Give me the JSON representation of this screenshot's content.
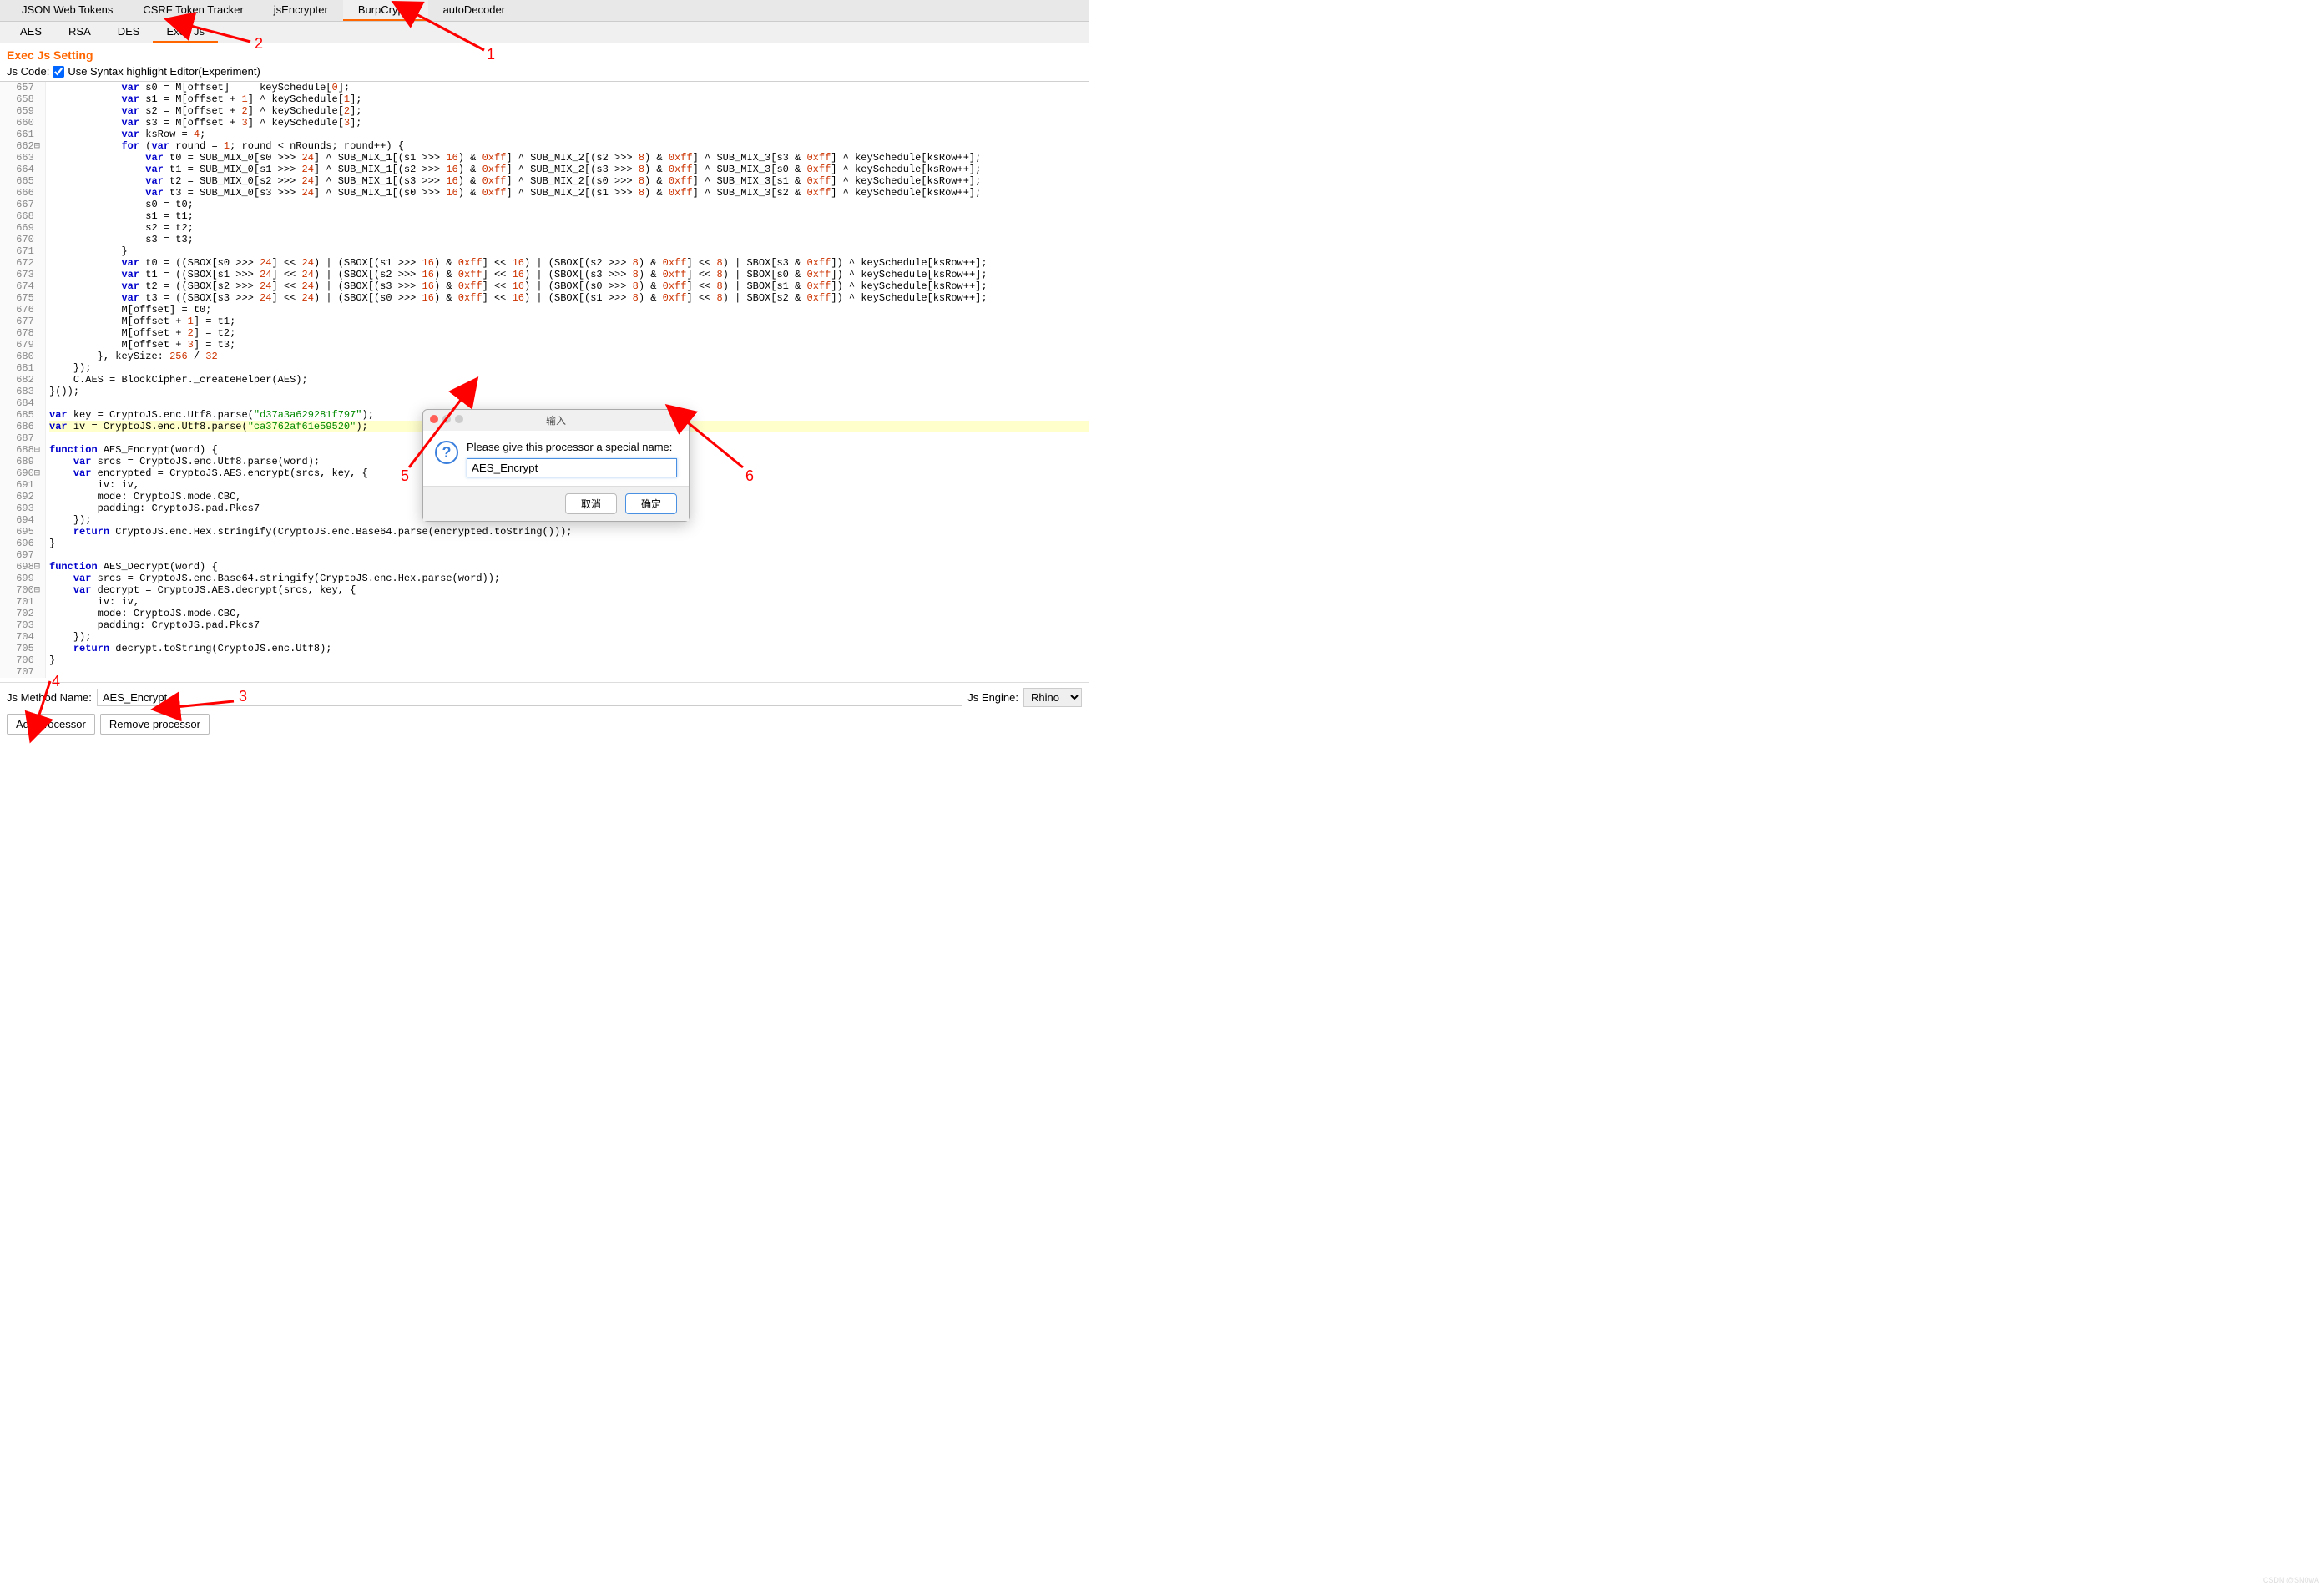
{
  "top_tabs": [
    "JSON Web Tokens",
    "CSRF Token Tracker",
    "jsEncrypter",
    "BurpCrypto",
    "autoDecoder"
  ],
  "top_active": "BurpCrypto",
  "sub_tabs": [
    "AES",
    "RSA",
    "DES",
    "Exec Js"
  ],
  "sub_active": "Exec Js",
  "section_title": "Exec Js Setting",
  "jscode_label": "Js Code:",
  "syntax_label": "Use Syntax highlight Editor(Experiment)",
  "syntax_checked": true,
  "method_label": "Js Method Name:",
  "method_value": "AES_Encrypt",
  "engine_label": "Js Engine:",
  "engine_value": "Rhino",
  "btn_add": "Add processor",
  "btn_remove": "Remove processor",
  "dialog": {
    "title": "输入",
    "prompt": "Please give this processor a special name:",
    "value": "AES_Encrypt",
    "cancel": "取消",
    "ok": "确定"
  },
  "annotations": [
    "1",
    "2",
    "3",
    "4",
    "5",
    "6"
  ],
  "gutter_start": 657,
  "gutter_end": 707,
  "code_lines": [
    {
      "n": 657,
      "html": "            <span class='kw'>var</span> s0 = M[offset]     keySchedule[<span class='num'>0</span>];"
    },
    {
      "n": 658,
      "html": "            <span class='kw'>var</span> s1 = M[offset + <span class='num'>1</span>] ^ keySchedule[<span class='num'>1</span>];"
    },
    {
      "n": 659,
      "html": "            <span class='kw'>var</span> s2 = M[offset + <span class='num'>2</span>] ^ keySchedule[<span class='num'>2</span>];"
    },
    {
      "n": 660,
      "html": "            <span class='kw'>var</span> s3 = M[offset + <span class='num'>3</span>] ^ keySchedule[<span class='num'>3</span>];"
    },
    {
      "n": 661,
      "html": "            <span class='kw'>var</span> ksRow = <span class='num'>4</span>;"
    },
    {
      "n": 662,
      "fold": "⊟",
      "html": "            <span class='kw'>for</span> (<span class='kw'>var</span> round = <span class='num'>1</span>; round &lt; nRounds; round++) {"
    },
    {
      "n": 663,
      "html": "                <span class='kw'>var</span> t0 = SUB_MIX_0[s0 &gt;&gt;&gt; <span class='num'>24</span>] ^ SUB_MIX_1[(s1 &gt;&gt;&gt; <span class='num'>16</span>) &amp; <span class='num'>0xff</span>] ^ SUB_MIX_2[(s2 &gt;&gt;&gt; <span class='num'>8</span>) &amp; <span class='num'>0xff</span>] ^ SUB_MIX_3[s3 &amp; <span class='num'>0xff</span>] ^ keySchedule[ksRow++];"
    },
    {
      "n": 664,
      "html": "                <span class='kw'>var</span> t1 = SUB_MIX_0[s1 &gt;&gt;&gt; <span class='num'>24</span>] ^ SUB_MIX_1[(s2 &gt;&gt;&gt; <span class='num'>16</span>) &amp; <span class='num'>0xff</span>] ^ SUB_MIX_2[(s3 &gt;&gt;&gt; <span class='num'>8</span>) &amp; <span class='num'>0xff</span>] ^ SUB_MIX_3[s0 &amp; <span class='num'>0xff</span>] ^ keySchedule[ksRow++];"
    },
    {
      "n": 665,
      "html": "                <span class='kw'>var</span> t2 = SUB_MIX_0[s2 &gt;&gt;&gt; <span class='num'>24</span>] ^ SUB_MIX_1[(s3 &gt;&gt;&gt; <span class='num'>16</span>) &amp; <span class='num'>0xff</span>] ^ SUB_MIX_2[(s0 &gt;&gt;&gt; <span class='num'>8</span>) &amp; <span class='num'>0xff</span>] ^ SUB_MIX_3[s1 &amp; <span class='num'>0xff</span>] ^ keySchedule[ksRow++];"
    },
    {
      "n": 666,
      "html": "                <span class='kw'>var</span> t3 = SUB_MIX_0[s3 &gt;&gt;&gt; <span class='num'>24</span>] ^ SUB_MIX_1[(s0 &gt;&gt;&gt; <span class='num'>16</span>) &amp; <span class='num'>0xff</span>] ^ SUB_MIX_2[(s1 &gt;&gt;&gt; <span class='num'>8</span>) &amp; <span class='num'>0xff</span>] ^ SUB_MIX_3[s2 &amp; <span class='num'>0xff</span>] ^ keySchedule[ksRow++];"
    },
    {
      "n": 667,
      "html": "                s0 = t0;"
    },
    {
      "n": 668,
      "html": "                s1 = t1;"
    },
    {
      "n": 669,
      "html": "                s2 = t2;"
    },
    {
      "n": 670,
      "html": "                s3 = t3;"
    },
    {
      "n": 671,
      "html": "            }"
    },
    {
      "n": 672,
      "html": "            <span class='kw'>var</span> t0 = ((SBOX[s0 &gt;&gt;&gt; <span class='num'>24</span>] &lt;&lt; <span class='num'>24</span>) | (SBOX[(s1 &gt;&gt;&gt; <span class='num'>16</span>) &amp; <span class='num'>0xff</span>] &lt;&lt; <span class='num'>16</span>) | (SBOX[(s2 &gt;&gt;&gt; <span class='num'>8</span>) &amp; <span class='num'>0xff</span>] &lt;&lt; <span class='num'>8</span>) | SBOX[s3 &amp; <span class='num'>0xff</span>]) ^ keySchedule[ksRow++];"
    },
    {
      "n": 673,
      "html": "            <span class='kw'>var</span> t1 = ((SBOX[s1 &gt;&gt;&gt; <span class='num'>24</span>] &lt;&lt; <span class='num'>24</span>) | (SBOX[(s2 &gt;&gt;&gt; <span class='num'>16</span>) &amp; <span class='num'>0xff</span>] &lt;&lt; <span class='num'>16</span>) | (SBOX[(s3 &gt;&gt;&gt; <span class='num'>8</span>) &amp; <span class='num'>0xff</span>] &lt;&lt; <span class='num'>8</span>) | SBOX[s0 &amp; <span class='num'>0xff</span>]) ^ keySchedule[ksRow++];"
    },
    {
      "n": 674,
      "html": "            <span class='kw'>var</span> t2 = ((SBOX[s2 &gt;&gt;&gt; <span class='num'>24</span>] &lt;&lt; <span class='num'>24</span>) | (SBOX[(s3 &gt;&gt;&gt; <span class='num'>16</span>) &amp; <span class='num'>0xff</span>] &lt;&lt; <span class='num'>16</span>) | (SBOX[(s0 &gt;&gt;&gt; <span class='num'>8</span>) &amp; <span class='num'>0xff</span>] &lt;&lt; <span class='num'>8</span>) | SBOX[s1 &amp; <span class='num'>0xff</span>]) ^ keySchedule[ksRow++];"
    },
    {
      "n": 675,
      "html": "            <span class='kw'>var</span> t3 = ((SBOX[s3 &gt;&gt;&gt; <span class='num'>24</span>] &lt;&lt; <span class='num'>24</span>) | (SBOX[(s0 &gt;&gt;&gt; <span class='num'>16</span>) &amp; <span class='num'>0xff</span>] &lt;&lt; <span class='num'>16</span>) | (SBOX[(s1 &gt;&gt;&gt; <span class='num'>8</span>) &amp; <span class='num'>0xff</span>] &lt;&lt; <span class='num'>8</span>) | SBOX[s2 &amp; <span class='num'>0xff</span>]) ^ keySchedule[ksRow++];"
    },
    {
      "n": 676,
      "html": "            M[offset] = t0;"
    },
    {
      "n": 677,
      "html": "            M[offset + <span class='num'>1</span>] = t1;"
    },
    {
      "n": 678,
      "html": "            M[offset + <span class='num'>2</span>] = t2;"
    },
    {
      "n": 679,
      "html": "            M[offset + <span class='num'>3</span>] = t3;"
    },
    {
      "n": 680,
      "html": "        }, keySize: <span class='num'>256</span> / <span class='num'>32</span>"
    },
    {
      "n": 681,
      "html": "    });"
    },
    {
      "n": 682,
      "html": "    C.AES = BlockCipher._createHelper(AES);"
    },
    {
      "n": 683,
      "html": "}());"
    },
    {
      "n": 684,
      "html": ""
    },
    {
      "n": 685,
      "html": "<span class='kw'>var</span> key = CryptoJS.enc.Utf8.parse(<span class='str'>\"d37a3a629281f797\"</span>);"
    },
    {
      "n": 686,
      "hl": true,
      "html": "<span class='kw'>var</span> iv = CryptoJS.enc.Utf8.parse(<span class='str'>\"ca3762af61e59520\"</span>);"
    },
    {
      "n": 687,
      "html": ""
    },
    {
      "n": 688,
      "fold": "⊟",
      "html": "<span class='kw'>function</span> AES_Encrypt(word) {"
    },
    {
      "n": 689,
      "html": "    <span class='kw'>var</span> srcs = CryptoJS.enc.Utf8.parse(word);"
    },
    {
      "n": 690,
      "fold": "⊟",
      "html": "    <span class='kw'>var</span> encrypted = CryptoJS.AES.encrypt(srcs, key, {"
    },
    {
      "n": 691,
      "html": "        iv: iv,"
    },
    {
      "n": 692,
      "html": "        mode: CryptoJS.mode.CBC,"
    },
    {
      "n": 693,
      "html": "        padding: CryptoJS.pad.Pkcs7"
    },
    {
      "n": 694,
      "html": "    });"
    },
    {
      "n": 695,
      "html": "    <span class='kw'>return</span> CryptoJS.enc.Hex.stringify(CryptoJS.enc.Base64.parse(encrypted.toString()));"
    },
    {
      "n": 696,
      "html": "}"
    },
    {
      "n": 697,
      "html": ""
    },
    {
      "n": 698,
      "fold": "⊟",
      "html": "<span class='kw'>function</span> AES_Decrypt(word) {"
    },
    {
      "n": 699,
      "html": "    <span class='kw'>var</span> srcs = CryptoJS.enc.Base64.stringify(CryptoJS.enc.Hex.parse(word));"
    },
    {
      "n": 700,
      "fold": "⊟",
      "html": "    <span class='kw'>var</span> decrypt = CryptoJS.AES.decrypt(srcs, key, {"
    },
    {
      "n": 701,
      "html": "        iv: iv,"
    },
    {
      "n": 702,
      "html": "        mode: CryptoJS.mode.CBC,"
    },
    {
      "n": 703,
      "html": "        padding: CryptoJS.pad.Pkcs7"
    },
    {
      "n": 704,
      "html": "    });"
    },
    {
      "n": 705,
      "html": "    <span class='kw'>return</span> decrypt.toString(CryptoJS.enc.Utf8);"
    },
    {
      "n": 706,
      "html": "}"
    },
    {
      "n": 707,
      "html": ""
    }
  ]
}
